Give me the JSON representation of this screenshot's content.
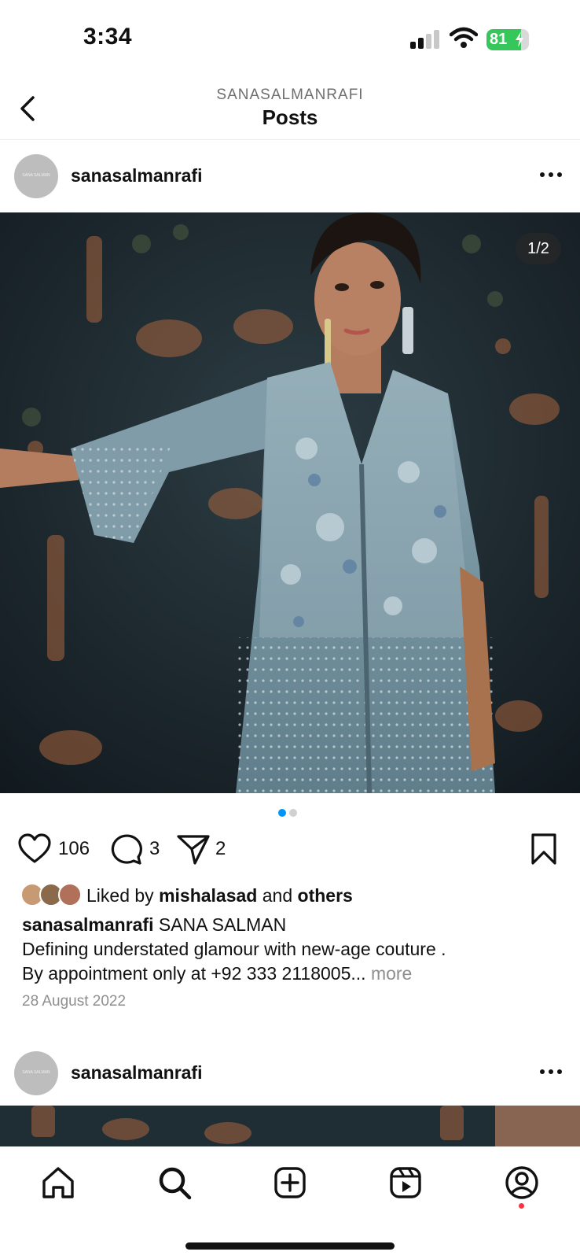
{
  "status_bar": {
    "time": "3:34",
    "battery_level": 81,
    "battery_text": "81"
  },
  "header": {
    "username_caps": "SANASALMANRAFI",
    "title": "Posts"
  },
  "post": {
    "username": "sanasalmanrafi",
    "avatar_text": "SANA SALMAN",
    "page_indicator": "1/2",
    "likes": "106",
    "comments": "3",
    "shares": "2",
    "liked_by_prefix": "Liked by ",
    "liked_by_user": "mishalasad",
    "liked_by_and": " and ",
    "liked_by_others": "others",
    "caption_user": "sanasalmanrafi",
    "caption_line1": " SANA SALMAN",
    "caption_line2": "Defining understated glamour with new-age couture .",
    "caption_line3": "By appointment only at +92 333 2118005...",
    "more": "more",
    "date": "28 August 2022",
    "carousel_current": 1,
    "carousel_total": 2
  },
  "next_post": {
    "username": "sanasalmanrafi",
    "avatar_text": "SANA SALMAN"
  },
  "tabs": [
    "home-icon",
    "search-icon",
    "create-icon",
    "reels-icon",
    "profile-icon"
  ],
  "colors": {
    "accent_blue": "#0095f6",
    "notification_red": "#ff3040",
    "battery_green": "#35c759"
  }
}
